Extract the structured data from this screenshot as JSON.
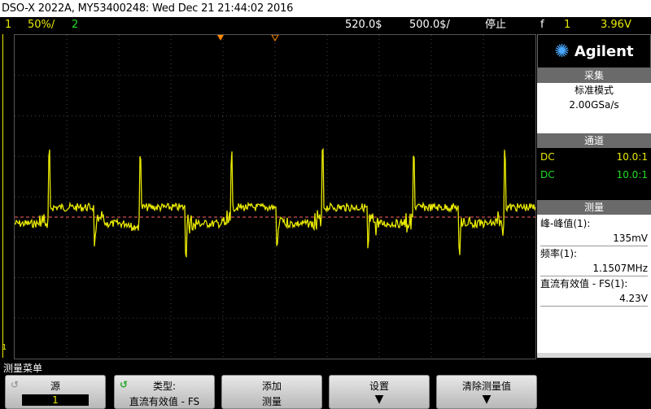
{
  "title": "DSO-X 2022A, MY53400248: Wed Dec 21 21:44:02 2016",
  "status": {
    "channel": "1",
    "vdiv": "50%/",
    "channel2": "2",
    "timebase": "520.0$",
    "offset": "500.0$/",
    "run_state": "停止",
    "trigger_icon": "f",
    "trigger_channel": "1",
    "trigger_level": "3.96V"
  },
  "brand": {
    "name": "Agilent"
  },
  "acquire": {
    "header": "采集",
    "mode": "标准模式",
    "rate": "2.00GSa/s"
  },
  "channels": {
    "header": "通道",
    "items": [
      {
        "coupling": "DC",
        "probe": "10.0:1",
        "color": "#e8e800"
      },
      {
        "coupling": "DC",
        "probe": "10.0:1",
        "color": "#22dd22"
      }
    ]
  },
  "measure": {
    "header": "测量",
    "items": [
      {
        "label": "峰-峰值(1):",
        "value": "135mV"
      },
      {
        "label": "频率(1):",
        "value": "1.1507MHz"
      },
      {
        "label": "直流有效值 - FS(1):",
        "value": "4.23V"
      }
    ]
  },
  "menu_label": "测量菜单",
  "softkeys": [
    {
      "top": "源",
      "bottom": "1"
    },
    {
      "top": "类型:",
      "bottom": "直流有效值 - FS"
    },
    {
      "top": "添加",
      "bottom": "测量"
    },
    {
      "top": "设置",
      "bottom": ""
    },
    {
      "top": "清除测量值",
      "bottom": ""
    }
  ],
  "ground_marker": "1",
  "colors": {
    "ch1": "#e8e800",
    "ch2": "#22dd22",
    "trigger": "#ff8800"
  }
}
